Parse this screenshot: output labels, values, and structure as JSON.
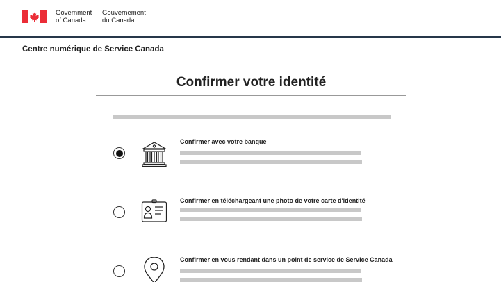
{
  "header": {
    "signature_en": [
      "Government",
      "of Canada"
    ],
    "signature_fr": [
      "Gouvernement",
      "du Canada"
    ],
    "flag_color": "#eb2d37",
    "rule_color": "#26374a"
  },
  "site": {
    "name": "Centre numérique de Service Canada"
  },
  "main": {
    "title": "Confirmer votre identité"
  },
  "options": [
    {
      "label": "Confirmer avec votre banque",
      "icon": "bank-icon",
      "selected": true
    },
    {
      "label": "Confirmer en téléchargeant une photo de votre carte d'identité",
      "icon": "id-card-icon",
      "selected": false
    },
    {
      "label": "Confirmer en vous rendant dans un point de service de Service Canada",
      "icon": "location-pin-icon",
      "selected": false
    }
  ]
}
